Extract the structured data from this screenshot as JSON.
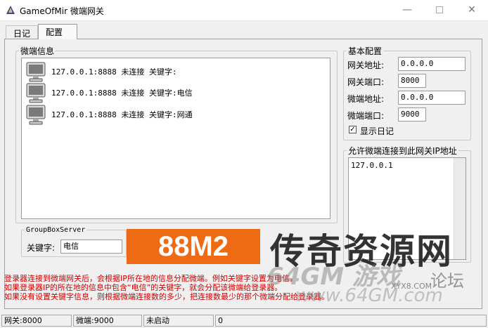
{
  "window": {
    "title": "GameOfMir 微端网关",
    "icon": "app-icon"
  },
  "tabs": [
    {
      "label": "日记"
    },
    {
      "label": "配置"
    }
  ],
  "micro_group": {
    "title": "微端信息",
    "items": [
      {
        "icon": "computer-icon",
        "text": "127.0.0.1:8888 未连接 关键字:"
      },
      {
        "icon": "computer-icon",
        "text": "127.0.0.1:8888 未连接 关键字:电信"
      },
      {
        "icon": "computer-icon",
        "text": "127.0.0.1:8888 未连接 关键字:网通"
      }
    ]
  },
  "basic": {
    "title": "基本配置",
    "gateway_addr_label": "网关地址:",
    "gateway_addr": "0.0.0.0",
    "gateway_port_label": "网关端口:",
    "gateway_port": "8000",
    "micro_addr_label": "微端地址:",
    "micro_addr": "0.0.0.0",
    "micro_port_label": "微端端口:",
    "micro_port": "9000",
    "show_log_label": "显示日记",
    "show_log_checked": true
  },
  "allow": {
    "title": "允许微端连接到此网关IP地址",
    "ips": [
      "127.0.0.1"
    ]
  },
  "server_group": {
    "title": "GroupBoxServer",
    "keyword_label": "关键字:",
    "keyword": "电信"
  },
  "info_lines": [
    "登录器连接到微端网关后，会根据IP所在地的信息分配微端。例如关键字设置为电信，",
    "如果登录器IP的所在地的信息中包含“电信”的关键字，就会分配该微端给登录器。",
    "如果没有设置关键字信息，则根据微端连接数的多少，把连接数最少的那个微端分配给登录器。"
  ],
  "watermarks": {
    "brand_box": "88M2",
    "brand_text": "传奇资源网",
    "site_big": "64GM 游戏",
    "site_url": "www.64GM.com",
    "forum": "论坛",
    "xyx": "XYX8.COM"
  },
  "status": {
    "gateway": "网关:8000",
    "micro": "微端:9000",
    "state": "未启动",
    "count": "0"
  },
  "colors": {
    "info_text": "#d00000",
    "brand_orange": "#ee6a14"
  }
}
